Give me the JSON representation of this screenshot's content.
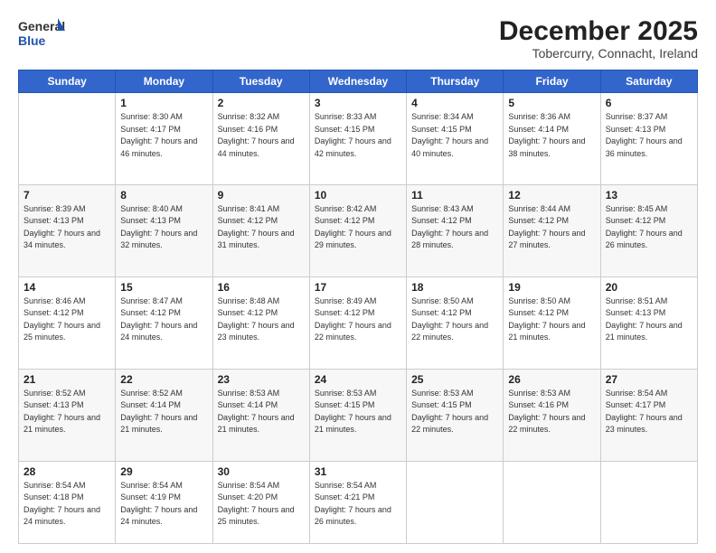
{
  "header": {
    "logo_line1": "General",
    "logo_line2": "Blue",
    "month": "December 2025",
    "location": "Tobercurry, Connacht, Ireland"
  },
  "weekdays": [
    "Sunday",
    "Monday",
    "Tuesday",
    "Wednesday",
    "Thursday",
    "Friday",
    "Saturday"
  ],
  "weeks": [
    [
      {
        "day": "",
        "sunrise": "",
        "sunset": "",
        "daylight": ""
      },
      {
        "day": "1",
        "sunrise": "Sunrise: 8:30 AM",
        "sunset": "Sunset: 4:17 PM",
        "daylight": "Daylight: 7 hours and 46 minutes."
      },
      {
        "day": "2",
        "sunrise": "Sunrise: 8:32 AM",
        "sunset": "Sunset: 4:16 PM",
        "daylight": "Daylight: 7 hours and 44 minutes."
      },
      {
        "day": "3",
        "sunrise": "Sunrise: 8:33 AM",
        "sunset": "Sunset: 4:15 PM",
        "daylight": "Daylight: 7 hours and 42 minutes."
      },
      {
        "day": "4",
        "sunrise": "Sunrise: 8:34 AM",
        "sunset": "Sunset: 4:15 PM",
        "daylight": "Daylight: 7 hours and 40 minutes."
      },
      {
        "day": "5",
        "sunrise": "Sunrise: 8:36 AM",
        "sunset": "Sunset: 4:14 PM",
        "daylight": "Daylight: 7 hours and 38 minutes."
      },
      {
        "day": "6",
        "sunrise": "Sunrise: 8:37 AM",
        "sunset": "Sunset: 4:13 PM",
        "daylight": "Daylight: 7 hours and 36 minutes."
      }
    ],
    [
      {
        "day": "7",
        "sunrise": "Sunrise: 8:39 AM",
        "sunset": "Sunset: 4:13 PM",
        "daylight": "Daylight: 7 hours and 34 minutes."
      },
      {
        "day": "8",
        "sunrise": "Sunrise: 8:40 AM",
        "sunset": "Sunset: 4:13 PM",
        "daylight": "Daylight: 7 hours and 32 minutes."
      },
      {
        "day": "9",
        "sunrise": "Sunrise: 8:41 AM",
        "sunset": "Sunset: 4:12 PM",
        "daylight": "Daylight: 7 hours and 31 minutes."
      },
      {
        "day": "10",
        "sunrise": "Sunrise: 8:42 AM",
        "sunset": "Sunset: 4:12 PM",
        "daylight": "Daylight: 7 hours and 29 minutes."
      },
      {
        "day": "11",
        "sunrise": "Sunrise: 8:43 AM",
        "sunset": "Sunset: 4:12 PM",
        "daylight": "Daylight: 7 hours and 28 minutes."
      },
      {
        "day": "12",
        "sunrise": "Sunrise: 8:44 AM",
        "sunset": "Sunset: 4:12 PM",
        "daylight": "Daylight: 7 hours and 27 minutes."
      },
      {
        "day": "13",
        "sunrise": "Sunrise: 8:45 AM",
        "sunset": "Sunset: 4:12 PM",
        "daylight": "Daylight: 7 hours and 26 minutes."
      }
    ],
    [
      {
        "day": "14",
        "sunrise": "Sunrise: 8:46 AM",
        "sunset": "Sunset: 4:12 PM",
        "daylight": "Daylight: 7 hours and 25 minutes."
      },
      {
        "day": "15",
        "sunrise": "Sunrise: 8:47 AM",
        "sunset": "Sunset: 4:12 PM",
        "daylight": "Daylight: 7 hours and 24 minutes."
      },
      {
        "day": "16",
        "sunrise": "Sunrise: 8:48 AM",
        "sunset": "Sunset: 4:12 PM",
        "daylight": "Daylight: 7 hours and 23 minutes."
      },
      {
        "day": "17",
        "sunrise": "Sunrise: 8:49 AM",
        "sunset": "Sunset: 4:12 PM",
        "daylight": "Daylight: 7 hours and 22 minutes."
      },
      {
        "day": "18",
        "sunrise": "Sunrise: 8:50 AM",
        "sunset": "Sunset: 4:12 PM",
        "daylight": "Daylight: 7 hours and 22 minutes."
      },
      {
        "day": "19",
        "sunrise": "Sunrise: 8:50 AM",
        "sunset": "Sunset: 4:12 PM",
        "daylight": "Daylight: 7 hours and 21 minutes."
      },
      {
        "day": "20",
        "sunrise": "Sunrise: 8:51 AM",
        "sunset": "Sunset: 4:13 PM",
        "daylight": "Daylight: 7 hours and 21 minutes."
      }
    ],
    [
      {
        "day": "21",
        "sunrise": "Sunrise: 8:52 AM",
        "sunset": "Sunset: 4:13 PM",
        "daylight": "Daylight: 7 hours and 21 minutes."
      },
      {
        "day": "22",
        "sunrise": "Sunrise: 8:52 AM",
        "sunset": "Sunset: 4:14 PM",
        "daylight": "Daylight: 7 hours and 21 minutes."
      },
      {
        "day": "23",
        "sunrise": "Sunrise: 8:53 AM",
        "sunset": "Sunset: 4:14 PM",
        "daylight": "Daylight: 7 hours and 21 minutes."
      },
      {
        "day": "24",
        "sunrise": "Sunrise: 8:53 AM",
        "sunset": "Sunset: 4:15 PM",
        "daylight": "Daylight: 7 hours and 21 minutes."
      },
      {
        "day": "25",
        "sunrise": "Sunrise: 8:53 AM",
        "sunset": "Sunset: 4:15 PM",
        "daylight": "Daylight: 7 hours and 22 minutes."
      },
      {
        "day": "26",
        "sunrise": "Sunrise: 8:53 AM",
        "sunset": "Sunset: 4:16 PM",
        "daylight": "Daylight: 7 hours and 22 minutes."
      },
      {
        "day": "27",
        "sunrise": "Sunrise: 8:54 AM",
        "sunset": "Sunset: 4:17 PM",
        "daylight": "Daylight: 7 hours and 23 minutes."
      }
    ],
    [
      {
        "day": "28",
        "sunrise": "Sunrise: 8:54 AM",
        "sunset": "Sunset: 4:18 PM",
        "daylight": "Daylight: 7 hours and 24 minutes."
      },
      {
        "day": "29",
        "sunrise": "Sunrise: 8:54 AM",
        "sunset": "Sunset: 4:19 PM",
        "daylight": "Daylight: 7 hours and 24 minutes."
      },
      {
        "day": "30",
        "sunrise": "Sunrise: 8:54 AM",
        "sunset": "Sunset: 4:20 PM",
        "daylight": "Daylight: 7 hours and 25 minutes."
      },
      {
        "day": "31",
        "sunrise": "Sunrise: 8:54 AM",
        "sunset": "Sunset: 4:21 PM",
        "daylight": "Daylight: 7 hours and 26 minutes."
      },
      {
        "day": "",
        "sunrise": "",
        "sunset": "",
        "daylight": ""
      },
      {
        "day": "",
        "sunrise": "",
        "sunset": "",
        "daylight": ""
      },
      {
        "day": "",
        "sunrise": "",
        "sunset": "",
        "daylight": ""
      }
    ]
  ]
}
